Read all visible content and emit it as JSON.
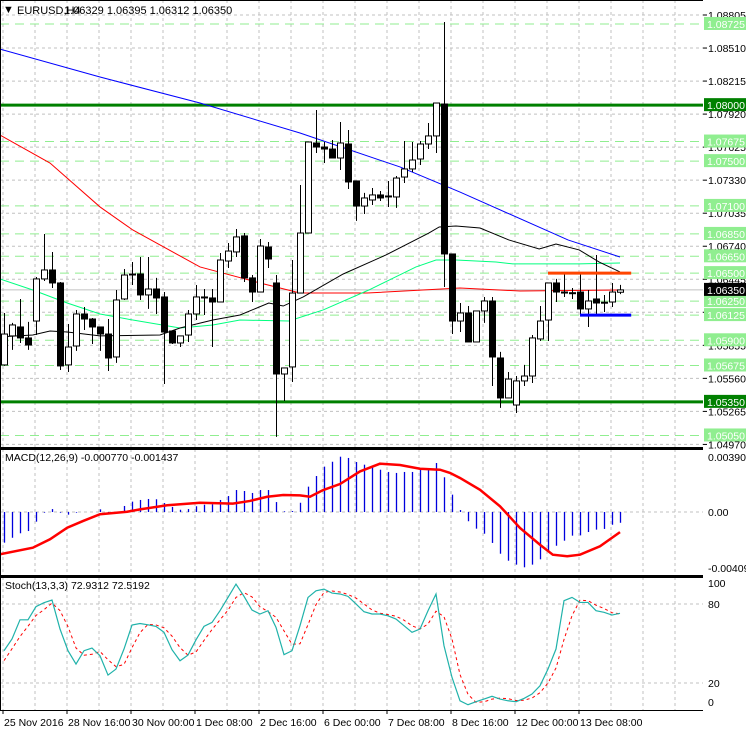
{
  "header": {
    "symbol": "EURUSD,H4",
    "ohlc": "1.06329 1.06395 1.06312 1.06350",
    "menu_icon": "triangle-down-icon"
  },
  "colors": {
    "bull_body": "#ffffff",
    "bear_body": "#000000",
    "candle_outline": "#000000",
    "level_light": "#90ee90",
    "level_dark": "#008000",
    "current_price": "#000000",
    "grid": "#c0c0c0",
    "orange_line": "#ff4500",
    "blue_line": "#0000ff",
    "macd_hist": "#0000dd",
    "macd_signal": "#ff0000",
    "stoch_main": "#20b2aa",
    "stoch_signal": "#ff0000"
  },
  "price_panel": {
    "range": [
      1.04947,
      1.08939
    ],
    "grid_labels": [
      "1.08805",
      "1.08510",
      "1.08215",
      "1.07920",
      "1.07625",
      "1.07330",
      "1.07035",
      "1.06740",
      "1.06445",
      "1.06150",
      "1.05855",
      "1.05560",
      "1.05265",
      "1.04970"
    ],
    "levels": [
      {
        "price": "1.08725",
        "style": "light"
      },
      {
        "price": "1.08000",
        "style": "dark"
      },
      {
        "price": "1.07675",
        "style": "light"
      },
      {
        "price": "1.07500",
        "style": "light"
      },
      {
        "price": "1.07100",
        "style": "light"
      },
      {
        "price": "1.06850",
        "style": "light"
      },
      {
        "price": "1.06650",
        "style": "light"
      },
      {
        "price": "1.06500",
        "style": "light"
      },
      {
        "price": "1.06250",
        "style": "light"
      },
      {
        "price": "1.06125",
        "style": "light"
      },
      {
        "price": "1.05900",
        "style": "light"
      },
      {
        "price": "1.05675",
        "style": "light"
      },
      {
        "price": "1.05350",
        "style": "dark"
      },
      {
        "price": "1.05050",
        "style": "light"
      }
    ],
    "current_price": "1.06350",
    "segments": [
      {
        "name": "orange-resistance-line",
        "price": 1.065,
        "from_bar": 68,
        "to_bar": 78.4,
        "color": "#ff4500"
      },
      {
        "name": "blue-support-line",
        "price": 1.06125,
        "from_bar": 72,
        "to_bar": 78.4,
        "color": "#0000ff"
      }
    ],
    "candles": [
      [
        1.0568,
        1.06144,
        1.05671,
        1.05956
      ],
      [
        1.05939,
        1.06055,
        1.05814,
        1.06037
      ],
      [
        1.06019,
        1.06269,
        1.05876,
        1.05921
      ],
      [
        1.05921,
        1.06064,
        1.05814,
        1.05858
      ],
      [
        1.06072,
        1.06465,
        1.05947,
        1.06448
      ],
      [
        1.06448,
        1.06849,
        1.0643,
        1.06528
      ],
      [
        1.06528,
        1.06689,
        1.06367,
        1.06412
      ],
      [
        1.06412,
        1.06421,
        1.05635,
        1.05671
      ],
      [
        1.0568,
        1.06046,
        1.05617,
        1.0584
      ],
      [
        1.05849,
        1.06171,
        1.05805,
        1.06135
      ],
      [
        1.06135,
        1.06197,
        1.05992,
        1.0609
      ],
      [
        1.0609,
        1.06099,
        1.05867,
        1.06019
      ],
      [
        1.06019,
        1.06019,
        1.05805,
        1.05956
      ],
      [
        1.05956,
        1.0609,
        1.05626,
        1.05742
      ],
      [
        1.05751,
        1.06349,
        1.05698,
        1.0626
      ],
      [
        1.06269,
        1.06537,
        1.0626,
        1.06483
      ],
      [
        1.06492,
        1.06599,
        1.06394,
        1.06483
      ],
      [
        1.06492,
        1.06644,
        1.0626,
        1.06305
      ],
      [
        1.06305,
        1.06644,
        1.0618,
        1.06358
      ],
      [
        1.06358,
        1.06457,
        1.06135,
        1.06278
      ],
      [
        1.06287,
        1.06331,
        1.0551,
        1.05974
      ],
      [
        1.05983,
        1.05983,
        1.05867,
        1.05876
      ],
      [
        1.05876,
        1.05939,
        1.0584,
        1.05939
      ],
      [
        1.05947,
        1.06171,
        1.05885,
        1.06135
      ],
      [
        1.06135,
        1.06394,
        1.06081,
        1.06287
      ],
      [
        1.06287,
        1.06358,
        1.06126,
        1.06278
      ],
      [
        1.06278,
        1.06358,
        1.0584,
        1.06242
      ],
      [
        1.06242,
        1.0668,
        1.06242,
        1.06617
      ],
      [
        1.06608,
        1.06769,
        1.06546,
        1.06697
      ],
      [
        1.06689,
        1.06894,
        1.06644,
        1.06823
      ],
      [
        1.06832,
        1.06858,
        1.06421,
        1.06457
      ],
      [
        1.06457,
        1.06483,
        1.06242,
        1.06331
      ],
      [
        1.06331,
        1.06805,
        1.06331,
        1.06742
      ],
      [
        1.06733,
        1.06778,
        1.06546,
        1.06626
      ],
      [
        1.06412,
        1.06483,
        1.05037,
        1.05599
      ],
      [
        1.05599,
        1.05653,
        1.05358,
        1.05653
      ],
      [
        1.05662,
        1.06617,
        1.05528,
        1.06322
      ],
      [
        1.06322,
        1.07287,
        1.06322,
        1.06858
      ],
      [
        1.06858,
        1.07671,
        1.06858,
        1.07671
      ],
      [
        1.07662,
        1.07957,
        1.07573,
        1.07626
      ],
      [
        1.07626,
        1.07671,
        1.07483,
        1.07608
      ],
      [
        1.07608,
        1.07689,
        1.07528,
        1.07528
      ],
      [
        1.07528,
        1.0785,
        1.07421,
        1.07662
      ],
      [
        1.07653,
        1.07778,
        1.07251,
        1.07314
      ],
      [
        1.07323,
        1.07323,
        1.06966,
        1.07099
      ],
      [
        1.07099,
        1.07216,
        1.07028,
        1.07171
      ],
      [
        1.07153,
        1.0726,
        1.07108,
        1.07198
      ],
      [
        1.07198,
        1.07233,
        1.07144,
        1.07171
      ],
      [
        1.07189,
        1.07323,
        1.0709,
        1.0718
      ],
      [
        1.0718,
        1.07367,
        1.07082,
        1.07349
      ],
      [
        1.07358,
        1.0768,
        1.07305,
        1.0743
      ],
      [
        1.0743,
        1.07671,
        1.07403,
        1.0751
      ],
      [
        1.07519,
        1.0768,
        1.07466,
        1.07653
      ],
      [
        1.07653,
        1.07841,
        1.07608,
        1.07725
      ],
      [
        1.07725,
        1.08019,
        1.07573,
        1.08019
      ],
      [
        1.0801,
        1.08743,
        1.06376,
        1.06671
      ],
      [
        1.06671,
        1.06671,
        1.05956,
        1.06072
      ],
      [
        1.06072,
        1.06233,
        1.05974,
        1.06144
      ],
      [
        1.06144,
        1.06206,
        1.05885,
        1.05885
      ],
      [
        1.05885,
        1.06162,
        1.05885,
        1.06162
      ],
      [
        1.06162,
        1.06287,
        1.06055,
        1.06251
      ],
      [
        1.06251,
        1.06287,
        1.05492,
        1.05751
      ],
      [
        1.05742,
        1.05796,
        1.05296,
        1.05385
      ],
      [
        1.05385,
        1.05617,
        1.05385,
        1.05554
      ],
      [
        1.05322,
        1.05581,
        1.05251,
        1.05537
      ],
      [
        1.05537,
        1.0568,
        1.05492,
        1.05581
      ],
      [
        1.05581,
        1.05947,
        1.05519,
        1.05921
      ],
      [
        1.05912,
        1.06206,
        1.05894,
        1.06072
      ],
      [
        1.06081,
        1.06412,
        1.05894,
        1.06412
      ],
      [
        1.06412,
        1.06448,
        1.06242,
        1.06331
      ],
      [
        1.06331,
        1.06492,
        1.06287,
        1.06322
      ],
      [
        1.06322,
        1.06367,
        1.06269,
        1.06325
      ],
      [
        1.06331,
        1.06492,
        1.06117,
        1.0618
      ],
      [
        1.0618,
        1.06349,
        1.06019,
        1.06251
      ],
      [
        1.06269,
        1.06662,
        1.06126,
        1.06233
      ],
      [
        1.06233,
        1.06305,
        1.06153,
        1.0624
      ],
      [
        1.06242,
        1.06412,
        1.06197,
        1.06331
      ],
      [
        1.06329,
        1.06395,
        1.06312,
        1.0635
      ]
    ],
    "moving_averages": [
      {
        "color": "#0000ff",
        "points": [
          [
            -0.5,
            1.08501
          ],
          [
            12,
            1.08251
          ],
          [
            24.5,
            1.08019
          ],
          [
            37,
            1.07751
          ],
          [
            49.5,
            1.07448
          ],
          [
            57,
            1.07224
          ],
          [
            70.5,
            1.06796
          ],
          [
            77,
            1.06644
          ]
        ]
      },
      {
        "color": "#ff0000",
        "points": [
          [
            -0.5,
            1.07733
          ],
          [
            5.75,
            1.07483
          ],
          [
            12,
            1.07091
          ],
          [
            16.1,
            1.06885
          ],
          [
            24.5,
            1.06555
          ],
          [
            32,
            1.06412
          ],
          [
            37,
            1.06322
          ],
          [
            45.4,
            1.06322
          ],
          [
            57,
            1.06367
          ],
          [
            64.5,
            1.0634
          ],
          [
            77,
            1.06349
          ]
        ]
      },
      {
        "color": "#00ff7f",
        "points": [
          [
            -0.5,
            1.06448
          ],
          [
            3.6,
            1.06349
          ],
          [
            7.9,
            1.06233
          ],
          [
            12,
            1.06135
          ],
          [
            16.1,
            1.06081
          ],
          [
            22,
            1.0601
          ],
          [
            26.1,
            1.06037
          ],
          [
            29.5,
            1.06081
          ],
          [
            35.6,
            1.06072
          ],
          [
            39.9,
            1.06171
          ],
          [
            45.6,
            1.06349
          ],
          [
            51.5,
            1.06555
          ],
          [
            54,
            1.06617
          ],
          [
            56.5,
            1.06617
          ],
          [
            61.5,
            1.06599
          ],
          [
            63.6,
            1.06582
          ],
          [
            71.9,
            1.06582
          ],
          [
            77,
            1.0659
          ]
        ]
      },
      {
        "color": "#000000",
        "points": [
          [
            -0.5,
            1.0593
          ],
          [
            3.6,
            1.05947
          ],
          [
            5.75,
            1.05983
          ],
          [
            7.9,
            1.05974
          ],
          [
            12,
            1.05939
          ],
          [
            19.5,
            1.05947
          ],
          [
            22,
            1.0601
          ],
          [
            26.1,
            1.06081
          ],
          [
            29.5,
            1.06126
          ],
          [
            33.1,
            1.06233
          ],
          [
            34.9,
            1.06206
          ],
          [
            37.4,
            1.06287
          ],
          [
            42.4,
            1.06492
          ],
          [
            47.75,
            1.06662
          ],
          [
            53.1,
            1.06858
          ],
          [
            54.4,
            1.06912
          ],
          [
            56.5,
            1.06921
          ],
          [
            59.5,
            1.06903
          ],
          [
            63.1,
            1.06796
          ],
          [
            66.9,
            1.06716
          ],
          [
            69,
            1.0676
          ],
          [
            71.9,
            1.06707
          ],
          [
            74.4,
            1.06599
          ],
          [
            77,
            1.0651
          ]
        ]
      }
    ]
  },
  "macd": {
    "label": "MACD(12,26,9) -0.000770 -0.001437",
    "range": [
      -0.0045,
      0.0045
    ],
    "max_label": "0.003908",
    "zero_label": "0.00",
    "min_label": "-0.004095",
    "histogram": [
      -0.00219,
      -0.00184,
      -0.00152,
      -0.00136,
      -0.00069,
      -5e-05,
      0.00021,
      -5e-05,
      -0.00019,
      -5e-05,
      0,
      0,
      0.00019,
      -0.00016,
      0,
      0.00043,
      0.00074,
      0.00086,
      0.00093,
      0.00091,
      0.00064,
      0.00036,
      0.00016,
      0.00021,
      0.00041,
      0.00052,
      0.00055,
      0.00086,
      0.00114,
      0.00157,
      0.0015,
      0.00136,
      0.00157,
      0.00157,
      0.00071,
      5e-05,
      7e-05,
      0.00066,
      0.00181,
      0.00257,
      0.00324,
      0.00359,
      0.00395,
      0.00386,
      0.00357,
      0.00338,
      0.00326,
      0.00302,
      0.00286,
      0.00279,
      0.00286,
      0.00286,
      0.00314,
      0.0031,
      0.0035,
      0.00248,
      0.00124,
      0.00014,
      -0.00066,
      -0.00119,
      -0.00155,
      -0.00221,
      -0.00298,
      -0.00348,
      -0.00376,
      -0.00395,
      -0.00376,
      -0.00338,
      -0.00286,
      -0.00241,
      -0.00205,
      -0.00169,
      -0.00167,
      -0.00143,
      -0.00126,
      -0.00121,
      -0.00091,
      -0.00077
    ],
    "signal": [
      [
        -0.5,
        -0.00302
      ],
      [
        3.6,
        -0.00255
      ],
      [
        5.75,
        -0.00195
      ],
      [
        7.9,
        -0.00112
      ],
      [
        9.9,
        -0.00064
      ],
      [
        12,
        -0.00016
      ],
      [
        15.4,
        2e-05
      ],
      [
        17,
        0.00019
      ],
      [
        20.4,
        0.00048
      ],
      [
        24.5,
        0.00066
      ],
      [
        28.6,
        0.0006
      ],
      [
        30.75,
        0.00079
      ],
      [
        32.9,
        0.00109
      ],
      [
        34.9,
        0.00121
      ],
      [
        37,
        0.00119
      ],
      [
        38.25,
        0.00109
      ],
      [
        39.9,
        0.00157
      ],
      [
        42,
        0.002
      ],
      [
        44.5,
        0.0029
      ],
      [
        47,
        0.00345
      ],
      [
        49.5,
        0.00336
      ],
      [
        52,
        0.00309
      ],
      [
        54.5,
        0.00302
      ],
      [
        55.75,
        0.00279
      ],
      [
        57,
        0.00243
      ],
      [
        59.5,
        0.00159
      ],
      [
        62,
        0.00041
      ],
      [
        64.5,
        -0.00114
      ],
      [
        67,
        -0.00234
      ],
      [
        68.6,
        -0.00305
      ],
      [
        70.4,
        -0.00316
      ],
      [
        72,
        -0.00305
      ],
      [
        74.5,
        -0.00245
      ],
      [
        77,
        -0.001437
      ]
    ]
  },
  "stoch": {
    "label": "Stoch(13,3,3) 72.9312 72.5192",
    "range": [
      -0.5,
      100.5
    ],
    "levels": [
      "100",
      "80",
      "20",
      "0"
    ],
    "main": [
      44.5,
      53.4,
      68,
      68,
      78,
      81,
      83,
      61,
      44.5,
      34.4,
      44.5,
      46.5,
      40.7,
      26,
      30.6,
      45.8,
      64,
      65.2,
      64.2,
      63,
      58.5,
      45.3,
      36.9,
      41.2,
      52.8,
      63,
      66,
      74.9,
      85,
      95.1,
      85.8,
      75.4,
      72.4,
      74.9,
      62.3,
      41.5,
      44.5,
      63.5,
      85,
      90,
      91.3,
      88.3,
      87.6,
      85.8,
      80,
      74.1,
      72.4,
      72.4,
      71,
      68.6,
      63.5,
      58.5,
      61,
      74.9,
      87.6,
      48.3,
      24.3,
      6.5,
      3.5,
      5.8,
      7.8,
      9.9,
      7.8,
      6.5,
      5.8,
      8.3,
      11.6,
      17.9,
      30.6,
      45.8,
      82.5,
      85,
      81.2,
      81.2,
      74.9,
      73.7,
      71.6,
      72.9312
    ],
    "signal": [
      37,
      46,
      55.3,
      63.1,
      71.3,
      75.7,
      80.7,
      75,
      62.8,
      46.6,
      41.1,
      41.8,
      43.9,
      37.7,
      32.4,
      34.1,
      46.8,
      58.3,
      64.5,
      64.1,
      61.9,
      55.6,
      46.9,
      41.1,
      43.6,
      52.3,
      60.6,
      68,
      75.3,
      85,
      88.6,
      85.4,
      77.9,
      74.2,
      69.9,
      59.6,
      49.4,
      49.8,
      64.3,
      79.5,
      88.8,
      89.9,
      89.1,
      87.2,
      84.5,
      80,
      75.5,
      73,
      71.9,
      70.7,
      67.7,
      63.5,
      61,
      64.8,
      74.5,
      70.3,
      53.4,
      26.4,
      11.4,
      5.3,
      5.7,
      7.8,
      8.5,
      8.1,
      6.7,
      6.9,
      8.6,
      12.6,
      20,
      31.4,
      53,
      71.1,
      82.9,
      82.5,
      79.1,
      76.6,
      73.4,
      72.5192
    ]
  },
  "time_axis": [
    {
      "bar": 0,
      "label": "25 Nov 2016"
    },
    {
      "bar": 8,
      "label": "28 Nov 16:00"
    },
    {
      "bar": 16,
      "label": "30 Nov 00:00"
    },
    {
      "bar": 24,
      "label": "1 Dec 08:00"
    },
    {
      "bar": 32,
      "label": "2 Dec 16:00"
    },
    {
      "bar": 40,
      "label": "6 Dec 00:00"
    },
    {
      "bar": 48,
      "label": "7 Dec 08:00"
    },
    {
      "bar": 56,
      "label": "8 Dec 16:00"
    },
    {
      "bar": 64,
      "label": "12 Dec 00:00"
    },
    {
      "bar": 72,
      "label": "13 Dec 08:00"
    }
  ]
}
